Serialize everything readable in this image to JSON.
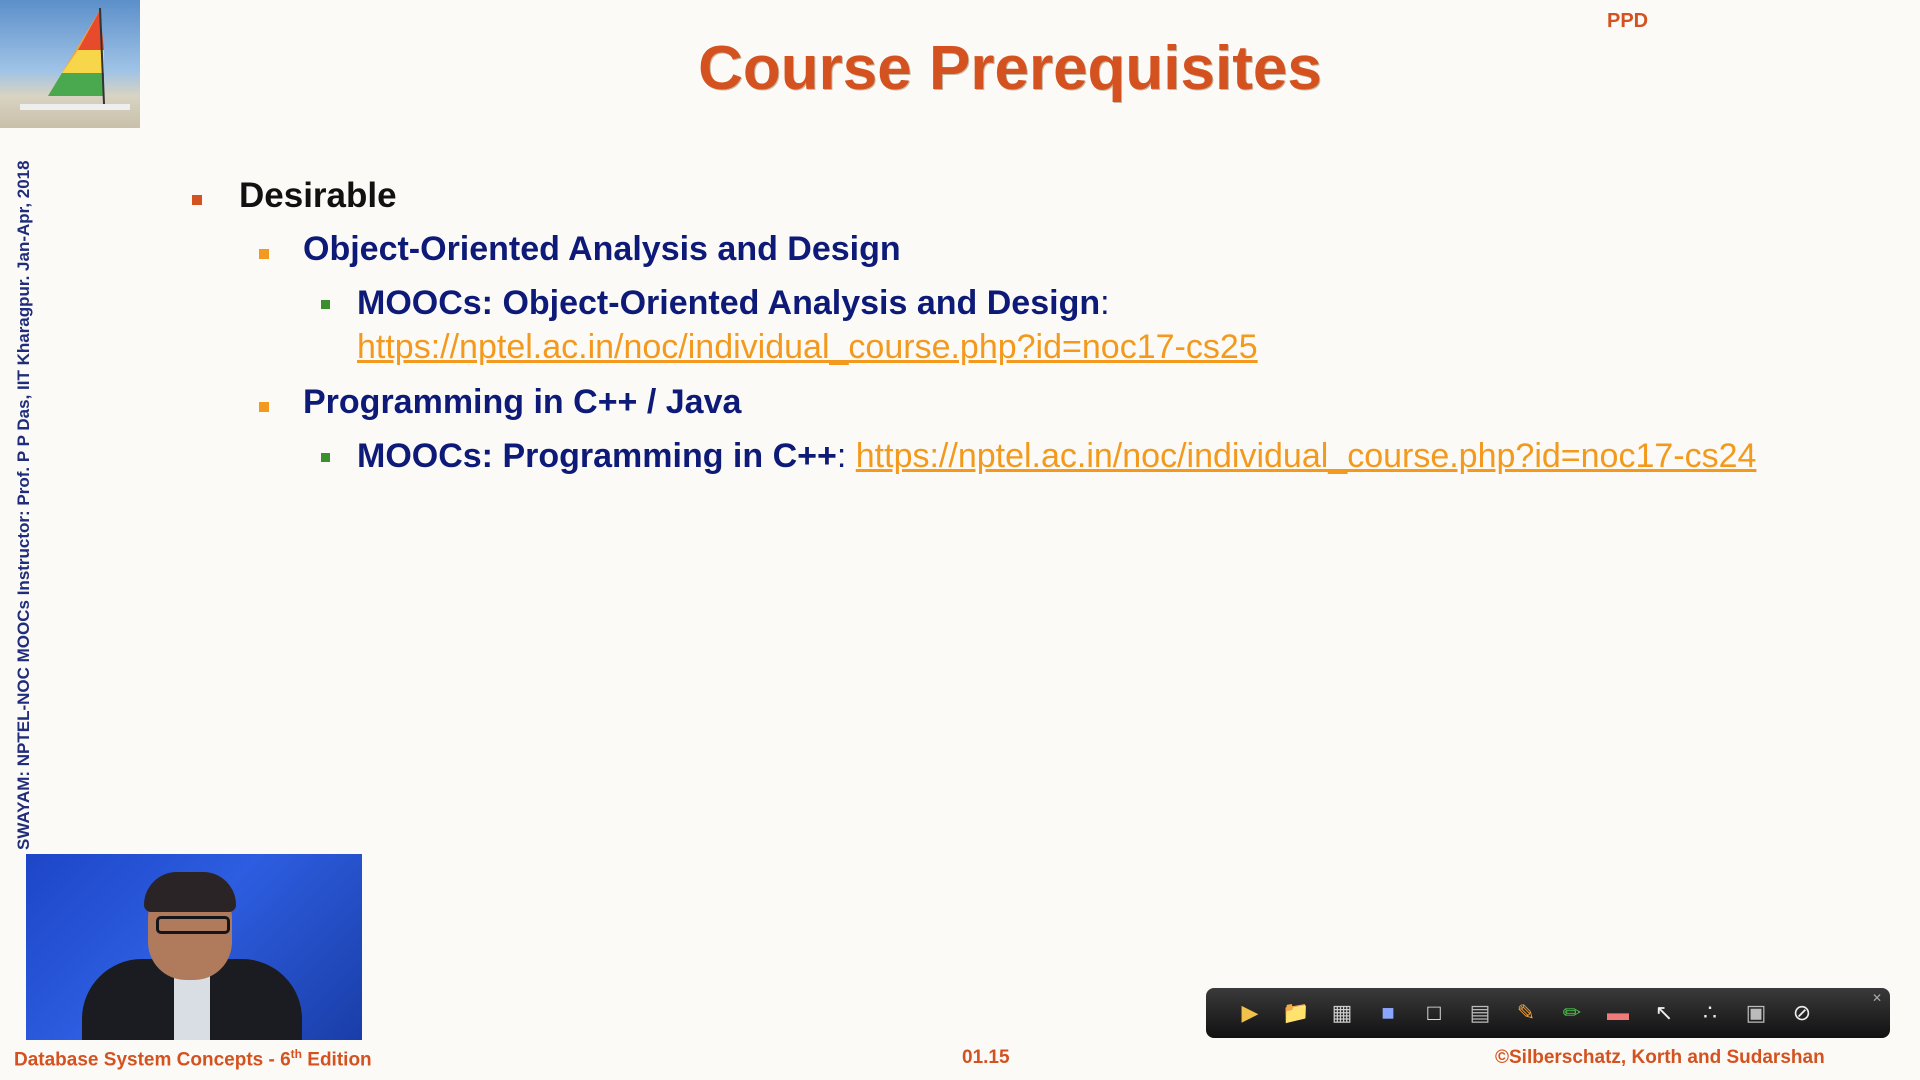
{
  "header": {
    "badge": "PPD",
    "title": "Course Prerequisites"
  },
  "sidebar": {
    "vertical_text": "SWAYAM: NPTEL-NOC MOOCs Instructor: Prof. P P Das, IIT Kharagpur. Jan-Apr, 2018"
  },
  "content": {
    "level1": "Desirable",
    "item1": {
      "heading": "Object-Oriented Analysis and Design",
      "sub_label": "MOOCs: Object-Oriented Analysis and Design",
      "separator": ":",
      "link": "https://nptel.ac.in/noc/individual_course.php?id=noc17-cs25"
    },
    "item2": {
      "heading": "Programming in C++ / Java",
      "sub_label": "MOOCs: Programming in C++",
      "separator": ":",
      "link": "https://nptel.ac.in/noc/individual_course.php?id=noc17-cs24"
    }
  },
  "footer": {
    "left_prefix": "Database System Concepts - 6",
    "left_sup": "th",
    "left_suffix": " Edition",
    "page": "01.15",
    "right": "©Silberschatz, Korth and Sudarshan"
  },
  "toolbar": {
    "icons": [
      "play-icon",
      "folder-icon",
      "slides-icon",
      "blackboard-icon",
      "whiteboard-icon",
      "screen-icon",
      "pen-icon",
      "highlighter-icon",
      "eraser-icon",
      "pointer-icon",
      "laser-icon",
      "clear-icon",
      "disable-icon"
    ]
  },
  "colors": {
    "title": "#d4521f",
    "heading": "#0e1a78",
    "link": "#f39a1e",
    "bullet_l1": "#d4521f",
    "bullet_l2": "#f39a1e",
    "bullet_l3": "#3b8f2d"
  }
}
